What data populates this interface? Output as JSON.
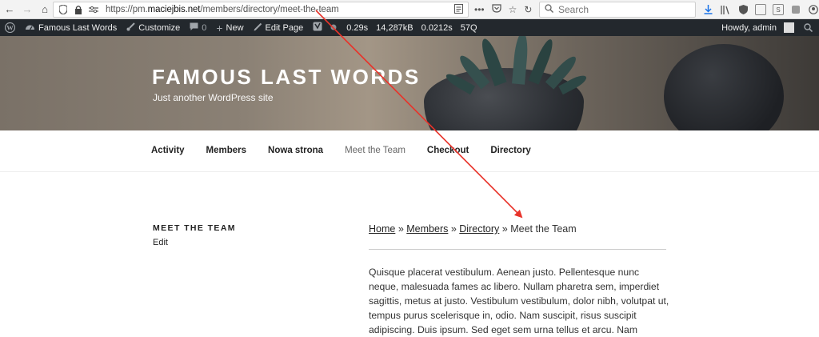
{
  "browser": {
    "url_prefix": "https://pm.",
    "url_domain": "maciejbis.net",
    "url_path": "/members/directory/meet-the-team",
    "search_placeholder": "Search"
  },
  "admin_bar": {
    "site_name": "Famous Last Words",
    "customize": "Customize",
    "comments_count": "0",
    "new": "New",
    "edit_page": "Edit Page",
    "time": "0.29s",
    "memory": "14,287kB",
    "query_time": "0.0212s",
    "queries": "57Q",
    "howdy": "Howdy, admin"
  },
  "header": {
    "title": "FAMOUS LAST WORDS",
    "description": "Just another WordPress site"
  },
  "nav": {
    "items": [
      {
        "label": "Activity"
      },
      {
        "label": "Members"
      },
      {
        "label": "Nowa strona"
      },
      {
        "label": "Meet the Team"
      },
      {
        "label": "Checkout"
      },
      {
        "label": "Directory"
      }
    ]
  },
  "sidebar": {
    "title": "MEET THE TEAM",
    "edit": "Edit"
  },
  "breadcrumb": {
    "home": "Home",
    "members": "Members",
    "directory": "Directory",
    "current": "Meet the Team",
    "sep": "»"
  },
  "content": {
    "paragraph": "Quisque placerat vestibulum. Aenean justo. Pellentesque nunc neque, malesuada fames ac libero. Nullam pharetra sem, imperdiet sagittis, metus at justo. Vestibulum vestibulum, dolor nibh, volutpat ut, tempus purus scelerisque in, odio. Nam suscipit, risus suscipit adipiscing. Duis ipsum. Sed eget sem urna tellus et arcu. Nam rhoncus, dui non eros ut"
  },
  "colors": {
    "admin_bar_bg": "#23282d",
    "annotation_arrow": "#e8332a"
  }
}
